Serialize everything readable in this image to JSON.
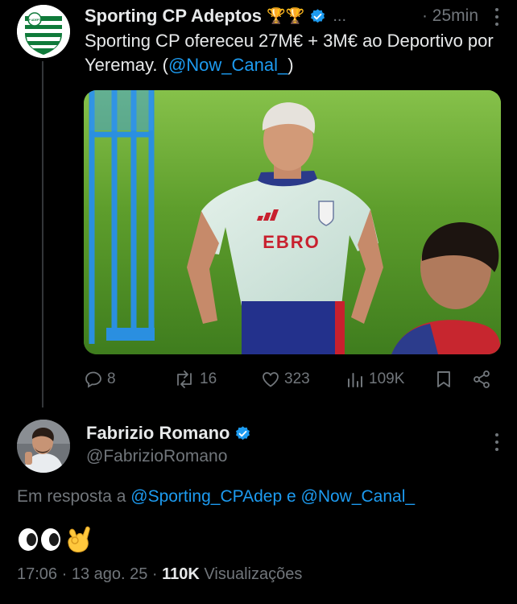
{
  "tweet1": {
    "author_name": "Sporting CP Adeptos",
    "trophy_emojis": "🏆🏆",
    "ellipsis": "...",
    "time": "· 25min",
    "avatar_logo_text": "SCP ADEPTOS",
    "text_before_link": "Sporting CP ofereceu 27M€  + 3M€ ao Deportivo por Yeremay. (",
    "text_link": "@Now_Canal_",
    "text_after_link": ")",
    "jersey_sponsor": "EBRO",
    "replies": "8",
    "reposts": "16",
    "likes": "323",
    "views": "109K"
  },
  "reply": {
    "author_name": "Fabrizio Romano",
    "handle": "@FabrizioRomano",
    "reply_label": "Em resposta a",
    "reply_mention_1": "@Sporting_CPAdep",
    "reply_conjunction": "e",
    "reply_mention_2": "@Now_Canal_",
    "emojis": "👀👌",
    "time": "17:06 · 13 ago. 25 ·",
    "views_count": "110K",
    "views_label": "Visualizações"
  },
  "colors": {
    "background": "#000000",
    "text": "#e7e9ea",
    "muted": "#71767b",
    "link": "#1d9bf0",
    "verified": "#1d9bf0"
  },
  "icons": [
    "more-icon",
    "verified-icon",
    "reply-icon",
    "repost-icon",
    "like-icon",
    "views-icon",
    "bookmark-icon",
    "share-icon"
  ]
}
